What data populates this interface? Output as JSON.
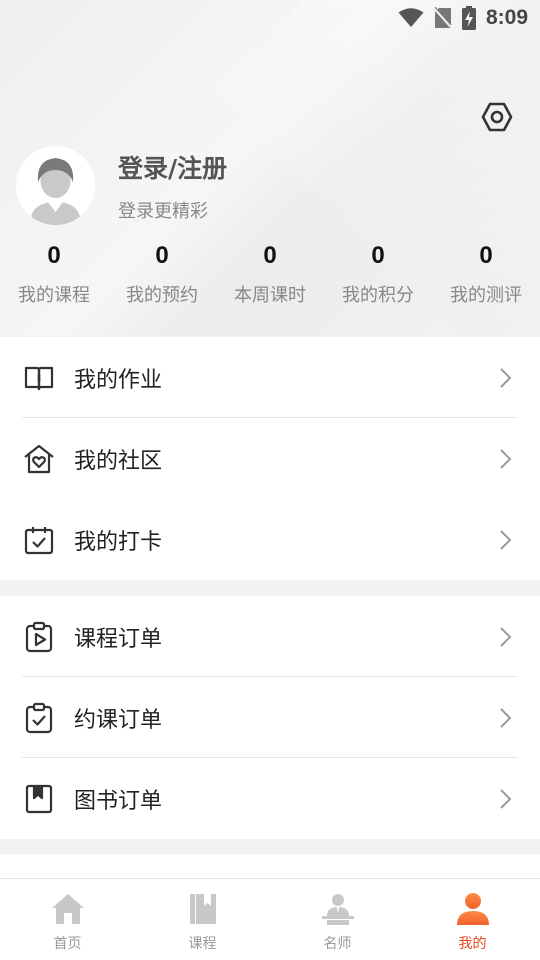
{
  "status_bar": {
    "time": "8:09",
    "icons": [
      "wifi-icon",
      "no-sim-icon",
      "battery-charging-icon"
    ]
  },
  "header": {
    "settings_icon": "gear-icon",
    "login_title": "登录/注册",
    "login_subtitle": "登录更精彩"
  },
  "stats": [
    {
      "value": "0",
      "label": "我的课程"
    },
    {
      "value": "0",
      "label": "我的预约"
    },
    {
      "value": "0",
      "label": "本周课时"
    },
    {
      "value": "0",
      "label": "我的积分"
    },
    {
      "value": "0",
      "label": "我的测评"
    }
  ],
  "menu_group_1": [
    {
      "label": "我的作业",
      "icon": "book-icon"
    },
    {
      "label": "我的社区",
      "icon": "home-heart-icon"
    },
    {
      "label": "我的打卡",
      "icon": "calendar-check-icon"
    }
  ],
  "menu_group_2": [
    {
      "label": "课程订单",
      "icon": "clipboard-play-icon"
    },
    {
      "label": "约课订单",
      "icon": "clipboard-check-icon"
    },
    {
      "label": "图书订单",
      "icon": "bookmark-icon"
    }
  ],
  "tabbar": [
    {
      "label": "首页",
      "icon": "home-icon",
      "active": false
    },
    {
      "label": "课程",
      "icon": "book-stack-icon",
      "active": false
    },
    {
      "label": "名师",
      "icon": "teacher-icon",
      "active": false
    },
    {
      "label": "我的",
      "icon": "user-icon",
      "active": true
    }
  ],
  "colors": {
    "accent": "#e14a1e",
    "accent_light": "#ff7a3d",
    "inactive_icon": "#c8c8c8"
  }
}
